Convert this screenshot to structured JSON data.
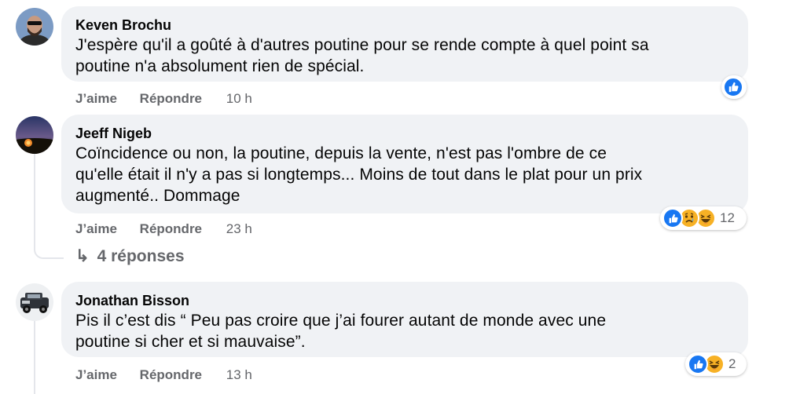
{
  "comments": [
    {
      "author": "Keven Brochu",
      "text": "J'espère qu'il a goûté à d'autres poutine pour se rende compte à quel point sa\npoutine n'a absolument rien de spécial.",
      "like_label": "J’aime",
      "reply_label": "Répondre",
      "time": "10 h",
      "reactions": [
        "like-icon"
      ],
      "reaction_count": ""
    },
    {
      "author": "Jeeff Nigeb",
      "text": "Coïncidence ou non, la poutine, depuis la vente, n'est pas l'ombre de ce\nqu'elle était il n'y a pas si longtemps... Moins de tout dans le plat pour un prix\naugmenté.. Dommage",
      "like_label": "J’aime",
      "reply_label": "Répondre",
      "time": "23 h",
      "reactions": [
        "like-icon",
        "sad-icon",
        "haha-icon"
      ],
      "reaction_count": "12",
      "replies_label": "4 réponses"
    },
    {
      "author": "Jonathan Bisson",
      "text": "Pis il c’est dis “ Peu pas croire que j’ai fourer autant de monde avec une\npoutine si cher et si mauvaise”.",
      "like_label": "J’aime",
      "reply_label": "Répondre",
      "time": "13 h",
      "reactions": [
        "like-icon",
        "haha-icon"
      ],
      "reaction_count": "2"
    }
  ],
  "colors": {
    "bubble": "#f0f2f5",
    "secondary_text": "#65676b",
    "like_blue": "#1877f2",
    "emoji_yellow": "#f7b125"
  }
}
